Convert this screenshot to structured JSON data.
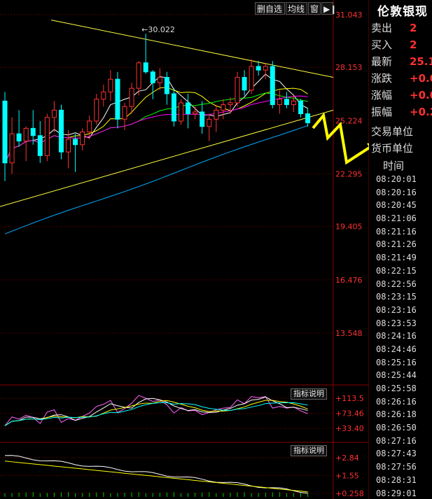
{
  "toolbar": {
    "remove_watchlist": "删自选",
    "ma_line": "均线",
    "window": "窗",
    "expand_icon": "expand-arrow-icon"
  },
  "price_axis": {
    "ticks": [
      "31.043",
      "28.153",
      "25.224",
      "22.295",
      "19.405",
      "16.476",
      "13.548"
    ]
  },
  "indicator1": {
    "label": "指标说明",
    "ticks": [
      "+113.5",
      "+73.46",
      "+33.40"
    ]
  },
  "indicator2": {
    "label": "指标说明",
    "ticks": [
      "+2.84",
      "+1.55",
      "+0.258"
    ]
  },
  "annotations": {
    "high_marker": "30.022"
  },
  "quote_panel": {
    "title": "伦敦银现",
    "rows": [
      {
        "label": "卖出",
        "value": "2"
      },
      {
        "label": "买入",
        "value": "2"
      },
      {
        "label": "最新",
        "value": "25.1"
      },
      {
        "label": "涨跌",
        "value": "+0.0"
      },
      {
        "label": "涨幅",
        "value": "+0.0"
      },
      {
        "label": "振幅",
        "value": "+0.2"
      }
    ],
    "trade_unit": "交易单位",
    "currency_unit": "货币单位",
    "time_header": "时间",
    "times": [
      "08:20:01",
      "08:20:16",
      "08:20:45",
      "08:21:06",
      "08:21:16",
      "08:21:26",
      "08:21:49",
      "08:22:15",
      "08:22:56",
      "08:23:15",
      "08:23:16",
      "08:23:53",
      "08:24:16",
      "08:24:46",
      "08:25:16",
      "08:25:44",
      "08:25:58",
      "08:26:16",
      "08:26:18",
      "08:26:50",
      "08:27:16",
      "08:27:43",
      "08:27:56",
      "08:28:31",
      "08:29:01"
    ]
  },
  "colors": {
    "up_candle": "#ff3232",
    "down_candle": "#00ffff",
    "trendline": "#ffff40",
    "ma5": "#ffffff",
    "ma10": "#ffff00",
    "ma20": "#00ff00",
    "ma30": "#ff00ff",
    "ma60": "#00aaff",
    "grid": "#8b0000",
    "axis_text": "#ff3030",
    "arrow": "#ffff00"
  },
  "chart_data": {
    "type": "candlestick",
    "ylim": [
      13.548,
      31.043
    ],
    "candles": [
      {
        "o": 26.3,
        "h": 26.8,
        "l": 21.9,
        "c": 22.9
      },
      {
        "o": 22.9,
        "h": 25.4,
        "l": 22.3,
        "c": 24.5
      },
      {
        "o": 24.5,
        "h": 25.8,
        "l": 23.8,
        "c": 24.1
      },
      {
        "o": 24.1,
        "h": 24.9,
        "l": 23.0,
        "c": 24.8
      },
      {
        "o": 24.8,
        "h": 25.8,
        "l": 23.9,
        "c": 24.4
      },
      {
        "o": 24.4,
        "h": 25.2,
        "l": 22.9,
        "c": 23.3
      },
      {
        "o": 23.3,
        "h": 25.6,
        "l": 23.0,
        "c": 25.4
      },
      {
        "o": 25.4,
        "h": 26.3,
        "l": 24.6,
        "c": 25.8
      },
      {
        "o": 25.8,
        "h": 26.1,
        "l": 23.1,
        "c": 23.5
      },
      {
        "o": 23.5,
        "h": 24.7,
        "l": 22.6,
        "c": 24.2
      },
      {
        "o": 24.2,
        "h": 24.5,
        "l": 22.4,
        "c": 23.9
      },
      {
        "o": 23.9,
        "h": 24.8,
        "l": 23.6,
        "c": 24.6
      },
      {
        "o": 24.6,
        "h": 25.5,
        "l": 24.2,
        "c": 25.2
      },
      {
        "o": 25.2,
        "h": 26.7,
        "l": 25.0,
        "c": 26.4
      },
      {
        "o": 26.4,
        "h": 27.2,
        "l": 26.0,
        "c": 26.8
      },
      {
        "o": 26.8,
        "h": 28.0,
        "l": 26.3,
        "c": 27.5
      },
      {
        "o": 27.5,
        "h": 27.9,
        "l": 24.8,
        "c": 25.3
      },
      {
        "o": 25.3,
        "h": 26.2,
        "l": 24.7,
        "c": 26.0
      },
      {
        "o": 26.0,
        "h": 27.3,
        "l": 25.6,
        "c": 27.0
      },
      {
        "o": 27.0,
        "h": 28.5,
        "l": 26.6,
        "c": 28.4
      },
      {
        "o": 28.4,
        "h": 30.0,
        "l": 27.8,
        "c": 27.9
      },
      {
        "o": 27.9,
        "h": 28.0,
        "l": 26.4,
        "c": 27.3
      },
      {
        "o": 27.3,
        "h": 28.1,
        "l": 26.9,
        "c": 27.6
      },
      {
        "o": 27.6,
        "h": 27.9,
        "l": 26.1,
        "c": 26.7
      },
      {
        "o": 26.7,
        "h": 27.0,
        "l": 24.9,
        "c": 25.2
      },
      {
        "o": 25.2,
        "h": 26.4,
        "l": 25.0,
        "c": 26.2
      },
      {
        "o": 26.2,
        "h": 26.7,
        "l": 24.8,
        "c": 25.6
      },
      {
        "o": 25.6,
        "h": 26.0,
        "l": 25.3,
        "c": 25.7
      },
      {
        "o": 25.7,
        "h": 26.3,
        "l": 24.5,
        "c": 24.9
      },
      {
        "o": 24.9,
        "h": 25.6,
        "l": 24.1,
        "c": 25.3
      },
      {
        "o": 25.3,
        "h": 26.1,
        "l": 24.6,
        "c": 25.8
      },
      {
        "o": 25.8,
        "h": 26.4,
        "l": 25.3,
        "c": 26.1
      },
      {
        "o": 26.1,
        "h": 26.5,
        "l": 25.6,
        "c": 26.2
      },
      {
        "o": 26.2,
        "h": 27.9,
        "l": 26.0,
        "c": 27.6
      },
      {
        "o": 27.6,
        "h": 28.0,
        "l": 26.6,
        "c": 26.9
      },
      {
        "o": 26.9,
        "h": 28.6,
        "l": 26.7,
        "c": 28.2
      },
      {
        "o": 28.2,
        "h": 28.5,
        "l": 27.7,
        "c": 28.0
      },
      {
        "o": 28.0,
        "h": 28.4,
        "l": 27.5,
        "c": 28.2
      },
      {
        "o": 28.2,
        "h": 28.5,
        "l": 25.9,
        "c": 26.1
      },
      {
        "o": 26.1,
        "h": 26.9,
        "l": 25.6,
        "c": 26.4
      },
      {
        "o": 26.4,
        "h": 26.8,
        "l": 25.9,
        "c": 26.1
      },
      {
        "o": 26.1,
        "h": 26.6,
        "l": 25.7,
        "c": 26.3
      },
      {
        "o": 26.3,
        "h": 26.4,
        "l": 25.4,
        "c": 25.6
      },
      {
        "o": 25.6,
        "h": 25.9,
        "l": 24.9,
        "c": 25.1
      }
    ],
    "indicator1_range": [
      0,
      140
    ],
    "indicator2_range": [
      0,
      3.3
    ]
  }
}
